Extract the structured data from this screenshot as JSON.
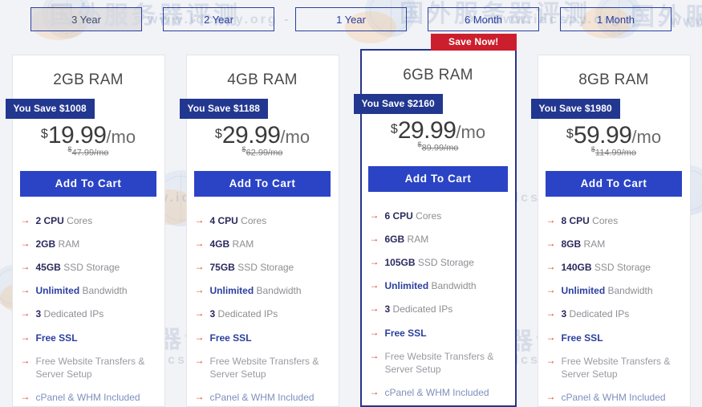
{
  "period_selector": {
    "options": [
      {
        "label": "3 Year",
        "active": true
      },
      {
        "label": "2 Year",
        "active": false
      },
      {
        "label": "1 Year",
        "active": false
      },
      {
        "label": "6 Month",
        "active": false
      },
      {
        "label": "1 Month",
        "active": false
      }
    ]
  },
  "colors": {
    "badge_blue": "#22378f",
    "button_blue": "#2b44c5",
    "ribbon_red": "#cc1f2e",
    "featured_border": "#27348b",
    "arrow_red": "#d0452f",
    "accent_blue": "#2b3f9e",
    "page_background": "#f2f3f6"
  },
  "ribbon_label": "Save Now!",
  "cta_label": "Add To Cart",
  "plans": [
    {
      "title": "2GB RAM",
      "save_badge": "You Save $1008",
      "currency": "$",
      "price": "19.99",
      "period": "/mo",
      "old_price": "47.99/mo",
      "featured": false,
      "features": [
        {
          "strong": "2 CPU",
          "rest": " Cores",
          "style": "strong"
        },
        {
          "strong": "2GB",
          "rest": " RAM",
          "style": "strong"
        },
        {
          "strong": "45GB",
          "rest": " SSD Storage",
          "style": "strong"
        },
        {
          "strong": "Unlimited",
          "rest": " Bandwidth",
          "style": "accent"
        },
        {
          "strong": "3",
          "rest": " Dedicated IPs",
          "style": "strong"
        },
        {
          "strong": "Free SSL",
          "rest": "",
          "style": "accent"
        },
        {
          "strong": "",
          "rest": "Free Website Transfers & Server Setup",
          "style": "muted"
        },
        {
          "strong": "",
          "rest": "cPanel & WHM Included",
          "style": "link"
        }
      ]
    },
    {
      "title": "4GB RAM",
      "save_badge": "You Save $1188",
      "currency": "$",
      "price": "29.99",
      "period": "/mo",
      "old_price": "62.99/mo",
      "featured": false,
      "features": [
        {
          "strong": "4 CPU",
          "rest": " Cores",
          "style": "strong"
        },
        {
          "strong": "4GB",
          "rest": " RAM",
          "style": "strong"
        },
        {
          "strong": "75GB",
          "rest": " SSD Storage",
          "style": "strong"
        },
        {
          "strong": "Unlimited",
          "rest": " Bandwidth",
          "style": "accent"
        },
        {
          "strong": "3",
          "rest": " Dedicated IPs",
          "style": "strong"
        },
        {
          "strong": "Free SSL",
          "rest": "",
          "style": "accent"
        },
        {
          "strong": "",
          "rest": "Free Website Transfers & Server Setup",
          "style": "muted"
        },
        {
          "strong": "",
          "rest": "cPanel & WHM Included",
          "style": "link"
        }
      ]
    },
    {
      "title": "6GB RAM",
      "save_badge": "You Save $2160",
      "currency": "$",
      "price": "29.99",
      "period": "/mo",
      "old_price": "89.99/mo",
      "featured": true,
      "features": [
        {
          "strong": "6 CPU",
          "rest": " Cores",
          "style": "strong"
        },
        {
          "strong": "6GB",
          "rest": " RAM",
          "style": "strong"
        },
        {
          "strong": "105GB",
          "rest": " SSD Storage",
          "style": "strong"
        },
        {
          "strong": "Unlimited",
          "rest": " Bandwidth",
          "style": "accent"
        },
        {
          "strong": "3",
          "rest": " Dedicated IPs",
          "style": "strong"
        },
        {
          "strong": "Free SSL",
          "rest": "",
          "style": "accent"
        },
        {
          "strong": "",
          "rest": "Free Website Transfers & Server Setup",
          "style": "muted"
        },
        {
          "strong": "",
          "rest": "cPanel & WHM Included",
          "style": "link"
        }
      ]
    },
    {
      "title": "8GB RAM",
      "save_badge": "You Save $1980",
      "currency": "$",
      "price": "59.99",
      "period": "/mo",
      "old_price": "114.99/mo",
      "featured": false,
      "features": [
        {
          "strong": "8 CPU",
          "rest": " Cores",
          "style": "strong"
        },
        {
          "strong": "8GB",
          "rest": " RAM",
          "style": "strong"
        },
        {
          "strong": "140GB",
          "rest": " SSD Storage",
          "style": "strong"
        },
        {
          "strong": "Unlimited",
          "rest": " Bandwidth",
          "style": "accent"
        },
        {
          "strong": "3",
          "rest": " Dedicated IPs",
          "style": "strong"
        },
        {
          "strong": "Free SSL",
          "rest": "",
          "style": "accent"
        },
        {
          "strong": "",
          "rest": "Free Website Transfers & Server Setup",
          "style": "muted"
        },
        {
          "strong": "",
          "rest": "cPanel & WHM Included",
          "style": "link"
        }
      ]
    }
  ],
  "watermark": {
    "cn_text": "国外服务器评测",
    "url_text": "- www.idcspy.org -",
    "arrow_glyph": "→"
  }
}
